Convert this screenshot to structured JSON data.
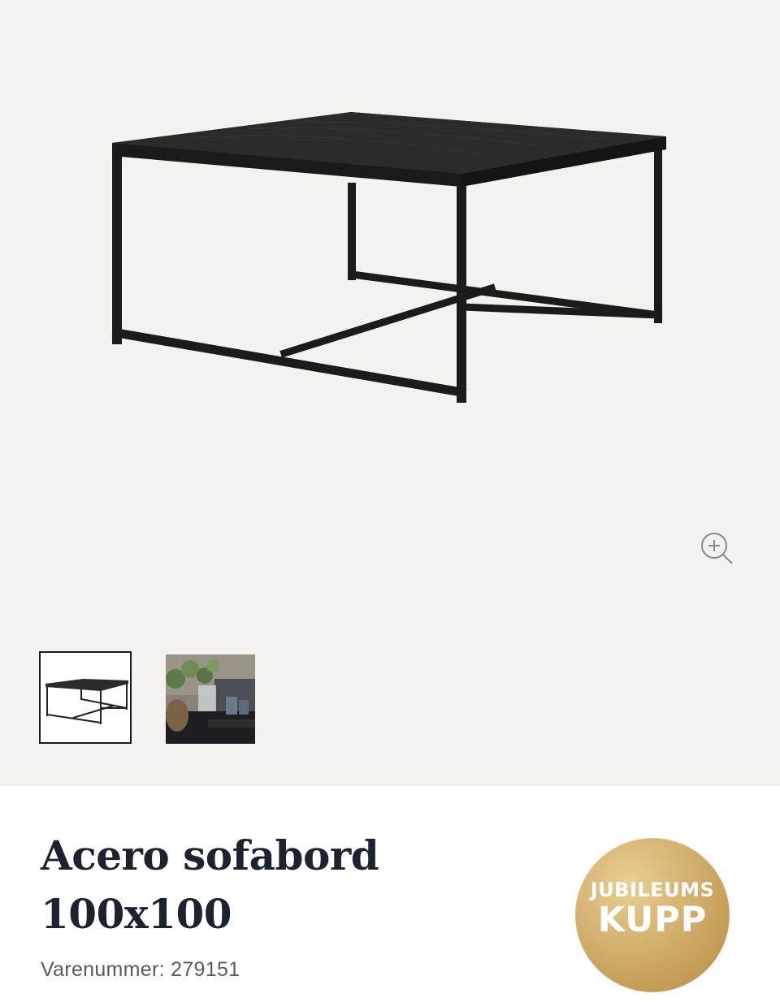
{
  "product": {
    "title_line1": "Acero sofabord",
    "title_line2": "100x100",
    "sku_text": "Varenummer: 279151"
  },
  "badge": {
    "line1": "JUBILEUMS",
    "line2": "KUPP"
  },
  "gallery": {
    "selected_thumbnail": 1,
    "thumbnail_count": 2
  },
  "colors": {
    "gallery_background": "#f4f2ef",
    "title": "#1c2230",
    "badge_gold": "#c8a25c"
  }
}
